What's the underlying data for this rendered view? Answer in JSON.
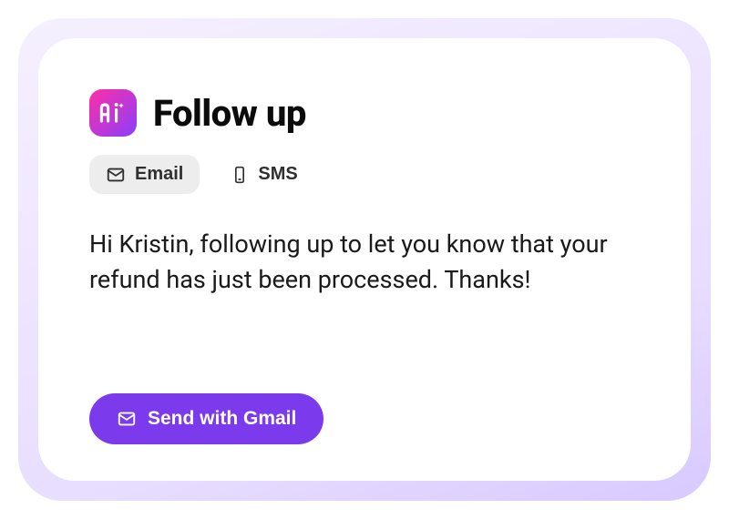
{
  "header": {
    "title": "Follow up",
    "badge_text": "Ai"
  },
  "tabs": {
    "email": {
      "label": "Email",
      "active": true
    },
    "sms": {
      "label": "SMS",
      "active": false
    }
  },
  "message": {
    "body": "Hi Kristin, following up to let you know that your refund has just been processed. Thanks!"
  },
  "actions": {
    "send_label": "Send with Gmail"
  },
  "colors": {
    "accent": "#7c3aed",
    "badge_gradient_start": "#ff2ea6",
    "badge_gradient_end": "#8a3ffc"
  }
}
